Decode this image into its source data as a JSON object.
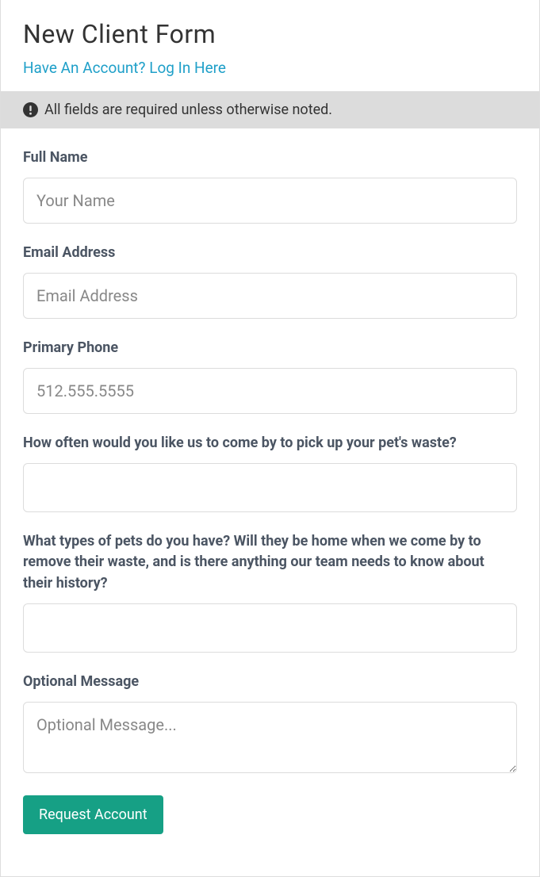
{
  "header": {
    "title": "New Client Form",
    "login_link_text": "Have An Account? Log In Here"
  },
  "notice": {
    "text": "All fields are required unless otherwise noted."
  },
  "form": {
    "full_name": {
      "label": "Full Name",
      "placeholder": "Your Name",
      "value": ""
    },
    "email": {
      "label": "Email Address",
      "placeholder": "Email Address",
      "value": ""
    },
    "phone": {
      "label": "Primary Phone",
      "placeholder": "512.555.5555",
      "value": ""
    },
    "frequency": {
      "label": "How often would you like us to come by to pick up your pet's waste?",
      "placeholder": "",
      "value": ""
    },
    "pet_info": {
      "label": "What types of pets do you have? Will they be home when we come by to remove their waste, and is there anything our team needs to know about their history?",
      "placeholder": "",
      "value": ""
    },
    "message": {
      "label": "Optional Message",
      "placeholder": "Optional Message...",
      "value": ""
    },
    "submit_label": "Request Account"
  }
}
